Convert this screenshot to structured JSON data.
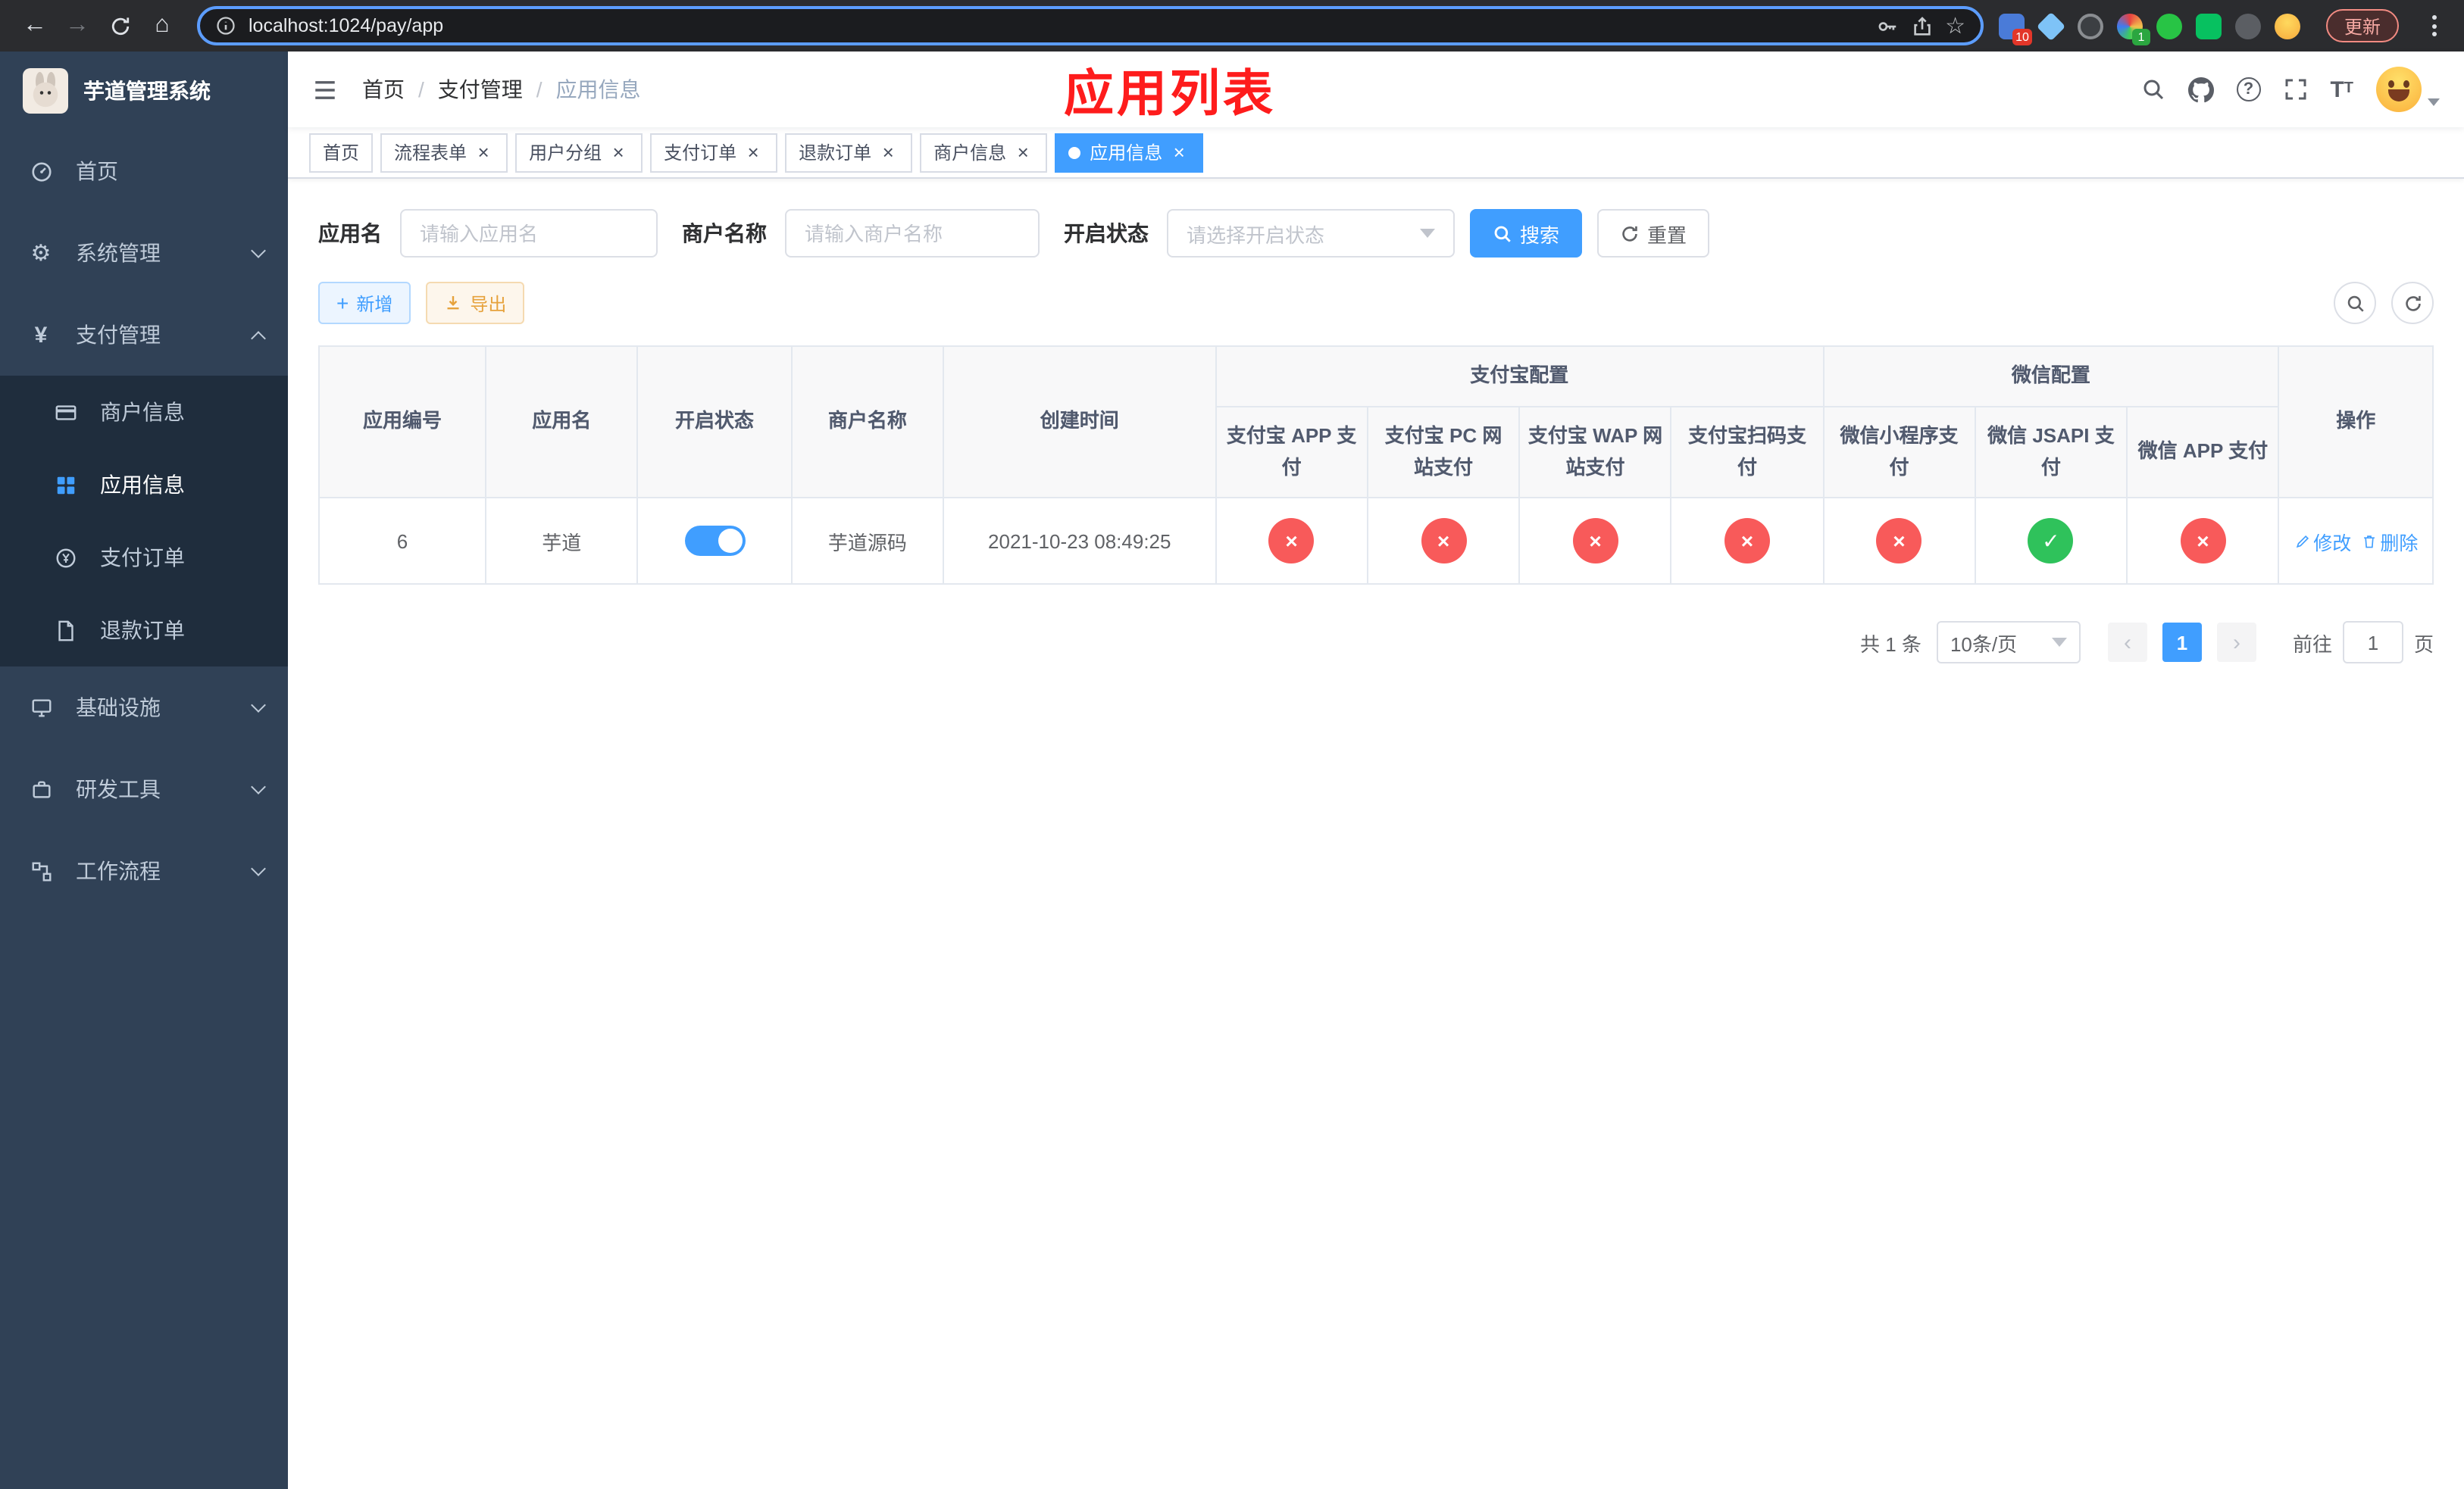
{
  "colors": {
    "accent": "#409eff",
    "danger": "#f85a5a",
    "success": "#2fc25b",
    "warning": "#e6a23c",
    "annotation": "#fe1c1c",
    "sidebar-bg": "#304156",
    "sidebar-sub-bg": "#1f2d3d"
  },
  "icons": {
    "back": "←",
    "forward": "→",
    "home": "⌂",
    "star": "☆",
    "gear": "⚙",
    "yen": "¥",
    "plus": "+",
    "close": "×",
    "question": "?",
    "check": "✓",
    "cross": "×",
    "chevron_left": "‹",
    "chevron_right": "›",
    "font_size_big": "T",
    "font_size_small": "T"
  },
  "browser": {
    "url": "localhost:1024/pay/app",
    "update_label": "更新",
    "extension_badge_1": "10",
    "extension_badge_2": "1"
  },
  "sidebar": {
    "title": "芋道管理系统",
    "items": [
      {
        "label": "首页",
        "icon": "dashboard-icon"
      },
      {
        "label": "系统管理",
        "icon": "gear-icon",
        "arrow": "down"
      },
      {
        "label": "支付管理",
        "icon": "yen-icon",
        "arrow": "up"
      },
      {
        "label": "商户信息",
        "icon": "bankcard-icon",
        "sub": true
      },
      {
        "label": "应用信息",
        "icon": "grid-icon",
        "sub": true,
        "active": true
      },
      {
        "label": "支付订单",
        "icon": "pay-order-icon",
        "sub": true
      },
      {
        "label": "退款订单",
        "icon": "refund-order-icon",
        "sub": true
      },
      {
        "label": "基础设施",
        "icon": "infrastructure-icon",
        "arrow": "down"
      },
      {
        "label": "研发工具",
        "icon": "dev-tools-icon",
        "arrow": "down"
      },
      {
        "label": "工作流程",
        "icon": "workflow-icon",
        "arrow": "down"
      }
    ]
  },
  "header": {
    "breadcrumb": [
      "首页",
      "支付管理",
      "应用信息"
    ],
    "separator": "/",
    "annotation": "应用列表",
    "right_icons": [
      "search-icon",
      "github-icon",
      "question-icon",
      "fullscreen-icon",
      "font-size-icon",
      "user-avatar"
    ]
  },
  "tabs": [
    {
      "label": "首页",
      "closable": false,
      "active": false
    },
    {
      "label": "流程表单",
      "closable": true,
      "active": false
    },
    {
      "label": "用户分组",
      "closable": true,
      "active": false
    },
    {
      "label": "支付订单",
      "closable": true,
      "active": false
    },
    {
      "label": "退款订单",
      "closable": true,
      "active": false
    },
    {
      "label": "商户信息",
      "closable": true,
      "active": false
    },
    {
      "label": "应用信息",
      "closable": true,
      "active": true
    }
  ],
  "filters": {
    "app_name_label": "应用名",
    "app_name_placeholder": "请输入应用名",
    "merchant_label": "商户名称",
    "merchant_placeholder": "请输入商户名称",
    "status_label": "开启状态",
    "status_placeholder": "请选择开启状态",
    "search_button": "搜索",
    "reset_button": "重置"
  },
  "toolbar": {
    "add_button": "新增",
    "export_button": "导出"
  },
  "table": {
    "col_app_id": "应用编号",
    "col_app_name": "应用名",
    "col_status": "开启状态",
    "col_merchant": "商户名称",
    "col_created": "创建时间",
    "group_alipay": "支付宝配置",
    "group_wechat": "微信配置",
    "sub_columns": [
      "支付宝 APP 支付",
      "支付宝 PC 网站支付",
      "支付宝 WAP 网站支付",
      "支付宝扫码支付",
      "微信小程序支付",
      "微信 JSAPI 支付",
      "微信 APP 支付"
    ],
    "col_actions": "操作",
    "rows": [
      {
        "app_id": "6",
        "app_name": "芋道",
        "enabled": true,
        "merchant": "芋道源码",
        "created": "2021-10-23 08:49:25",
        "configs": [
          "no",
          "no",
          "no",
          "no",
          "no",
          "yes",
          "no"
        ],
        "edit_label": "修改",
        "delete_label": "删除"
      }
    ]
  },
  "pagination": {
    "total": "共 1 条",
    "page_size": "10条/页",
    "page": "1",
    "goto_label": "前往",
    "goto_value": "1",
    "goto_unit": "页"
  }
}
